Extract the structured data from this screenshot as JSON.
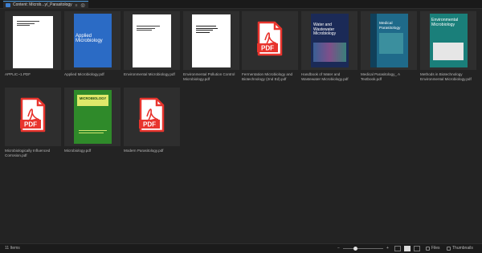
{
  "tab": {
    "title": "Content: Microb...y/_Parasitology",
    "menu_glyph": "≡",
    "close_glyph": "⨂"
  },
  "items": [
    {
      "label": "APPLIC~1.PDF",
      "kind": "doc"
    },
    {
      "label": "Applied Microbiology.pdf",
      "kind": "cover",
      "cover_title": "Applied Microbiology",
      "cover_color": "#2b6bc5"
    },
    {
      "label": "Environmental Microbiology.pdf",
      "kind": "doc"
    },
    {
      "label": "Environmental Pollution Control Microbiology.pdf",
      "kind": "doc"
    },
    {
      "label": "Fermentation Microbiology and Biotechnology (2nd Ed).pdf",
      "kind": "pdf"
    },
    {
      "label": "Handbook of Water and Wastewater Microbiology.pdf",
      "kind": "cover",
      "cover_title": "Water and Wastewater Microbiology",
      "cover_color": "#1b2a57"
    },
    {
      "label": "Medical Parasitology_ A Textbook.pdf",
      "kind": "cover",
      "cover_title": "Medical Parasitology",
      "cover_color": "#1f6a8a"
    },
    {
      "label": "Methods in Biotechnology Environmental Microbiology.pdf",
      "kind": "cover",
      "cover_title": "Environmental Microbiology",
      "cover_color": "#1a7f7a"
    },
    {
      "label": "Microbiologically Influenced Corrosion.pdf",
      "kind": "pdf"
    },
    {
      "label": "Microbiology.pdf",
      "kind": "cover",
      "cover_title": "MICROBIOLOGY",
      "cover_color": "#2f8a2a"
    },
    {
      "label": "Modern Parasitology.pdf",
      "kind": "pdf"
    }
  ],
  "pdf_badge": "PDF",
  "footer": {
    "count": "11 Items",
    "zoom_level": 0.3,
    "zoom_minus": "−",
    "zoom_plus": "+",
    "files_label": "Files",
    "thumbnails_only_label": "Thumbnails Only"
  },
  "colors": {
    "pdf_red": "#e8342d",
    "accent": "#4a9bdf"
  }
}
